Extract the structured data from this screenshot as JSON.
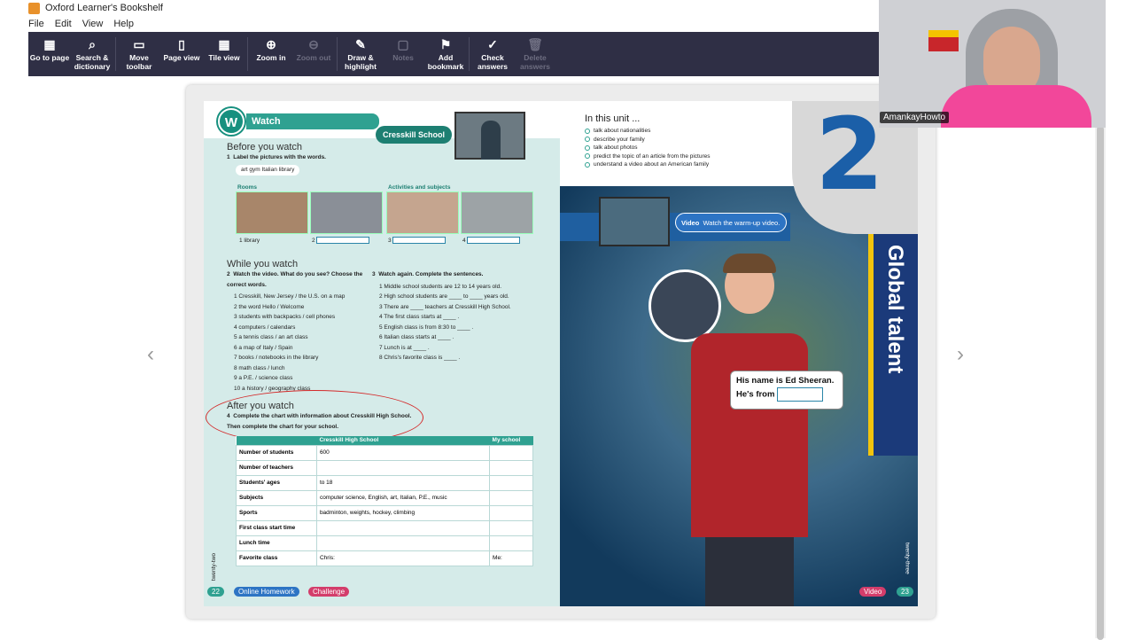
{
  "window": {
    "title": "Oxford Learner's Bookshelf"
  },
  "menu": [
    "File",
    "Edit",
    "View",
    "Help"
  ],
  "app_name": "Oxford Learner's Bookshelf",
  "toolbar": [
    {
      "label": "Go to page",
      "icon": "grid-icon",
      "enabled": true
    },
    {
      "label": "Search & dictionary",
      "icon": "search-icon",
      "enabled": true
    },
    {
      "label": "Move toolbar",
      "icon": "window-icon",
      "enabled": true
    },
    {
      "label": "Page view",
      "icon": "page-icon",
      "enabled": true
    },
    {
      "label": "Tile view",
      "icon": "tile-icon",
      "enabled": true
    },
    {
      "label": "Zoom in",
      "icon": "zoom-in-icon",
      "enabled": true
    },
    {
      "label": "Zoom out",
      "icon": "zoom-out-icon",
      "enabled": false
    },
    {
      "label": "Draw & highlight",
      "icon": "pen-icon",
      "enabled": true
    },
    {
      "label": "Notes",
      "icon": "note-icon",
      "enabled": false
    },
    {
      "label": "Add bookmark",
      "icon": "bookmark-icon",
      "enabled": true
    },
    {
      "label": "Check answers",
      "icon": "check-icon",
      "enabled": true
    },
    {
      "label": "Delete answers",
      "icon": "trash-icon",
      "enabled": false
    }
  ],
  "left_page": {
    "watch_badge": "W",
    "watch_title": "Watch",
    "school_pill": "Cresskill School",
    "before_title": "Before you watch",
    "ex1": {
      "num": "1",
      "instruction": "Label the pictures with the words.",
      "words": "art   gym   Italian   library"
    },
    "rooms_label": "Rooms",
    "activities_label": "Activities and subjects",
    "photo_answers": [
      "1  library",
      "2",
      "3",
      "4"
    ],
    "while_title": "While you watch",
    "ex2": {
      "num": "2",
      "instruction": "Watch the video. What do you see? Choose the correct words.",
      "items": [
        "1  Cresskill, New Jersey / the U.S. on a map",
        "2  the word Hello / Welcome",
        "3  students with backpacks / cell phones",
        "4  computers / calendars",
        "5  a tennis class / an art class",
        "6  a map of Italy / Spain",
        "7  books / notebooks in the library",
        "8  math class / lunch",
        "9  a P.E. / science class",
        "10  a history / geography class"
      ]
    },
    "ex3": {
      "num": "3",
      "instruction": "Watch again. Complete the sentences.",
      "items": [
        "1  Middle school students are  12  to  14  years old.",
        "2  High school students are  ____  to  ____  years old.",
        "3  There are  ____  teachers at Cresskill High School.",
        "4  The first class starts at  ____ .",
        "5  English class is from 8:30 to  ____ .",
        "6  Italian class starts at  ____ .",
        "7  Lunch is at  ____ .",
        "8  Chris's favorite class is  ____ ."
      ]
    },
    "after_title": "After you watch",
    "ex4": {
      "num": "4",
      "instruction": "Complete the chart with information about Cresskill High School. Then complete the chart for your school."
    },
    "chart": {
      "col1": "Cresskill High School",
      "col2": "My school",
      "rows": [
        {
          "label": "Number of students",
          "value": "600"
        },
        {
          "label": "Number of teachers",
          "value": ""
        },
        {
          "label": "Students' ages",
          "value": "to 18"
        },
        {
          "label": "Subjects",
          "value": "computer science, English, art, Italian, P.E., music"
        },
        {
          "label": "Sports",
          "value": "badminton, weights, hockey, climbing"
        },
        {
          "label": "First class start time",
          "value": ""
        },
        {
          "label": "Lunch time",
          "value": ""
        },
        {
          "label": "Favorite class",
          "value": "Chris:"
        }
      ],
      "my_school_fav": "Me:"
    },
    "page_number": "22",
    "online_homework": "Online Homework",
    "challenge": "Challenge",
    "side_text": "twenty-two"
  },
  "right_page": {
    "unit_title": "In this unit ...",
    "unit_items": [
      "talk about nationalities",
      "describe your family",
      "talk about photos",
      "predict the topic of an article from the pictures",
      "understand a video about an American family"
    ],
    "unit_number": "2",
    "vertical_title": "Global talent",
    "video_label": "Video",
    "video_pill": "Watch the warm-up video.",
    "speech_line1": "His name is Ed Sheeran.",
    "speech_line2": "He's from",
    "page_number": "23",
    "footer_video": "Video",
    "side_text": "twenty-three"
  },
  "webcam": {
    "name": "AmankayHowto"
  }
}
